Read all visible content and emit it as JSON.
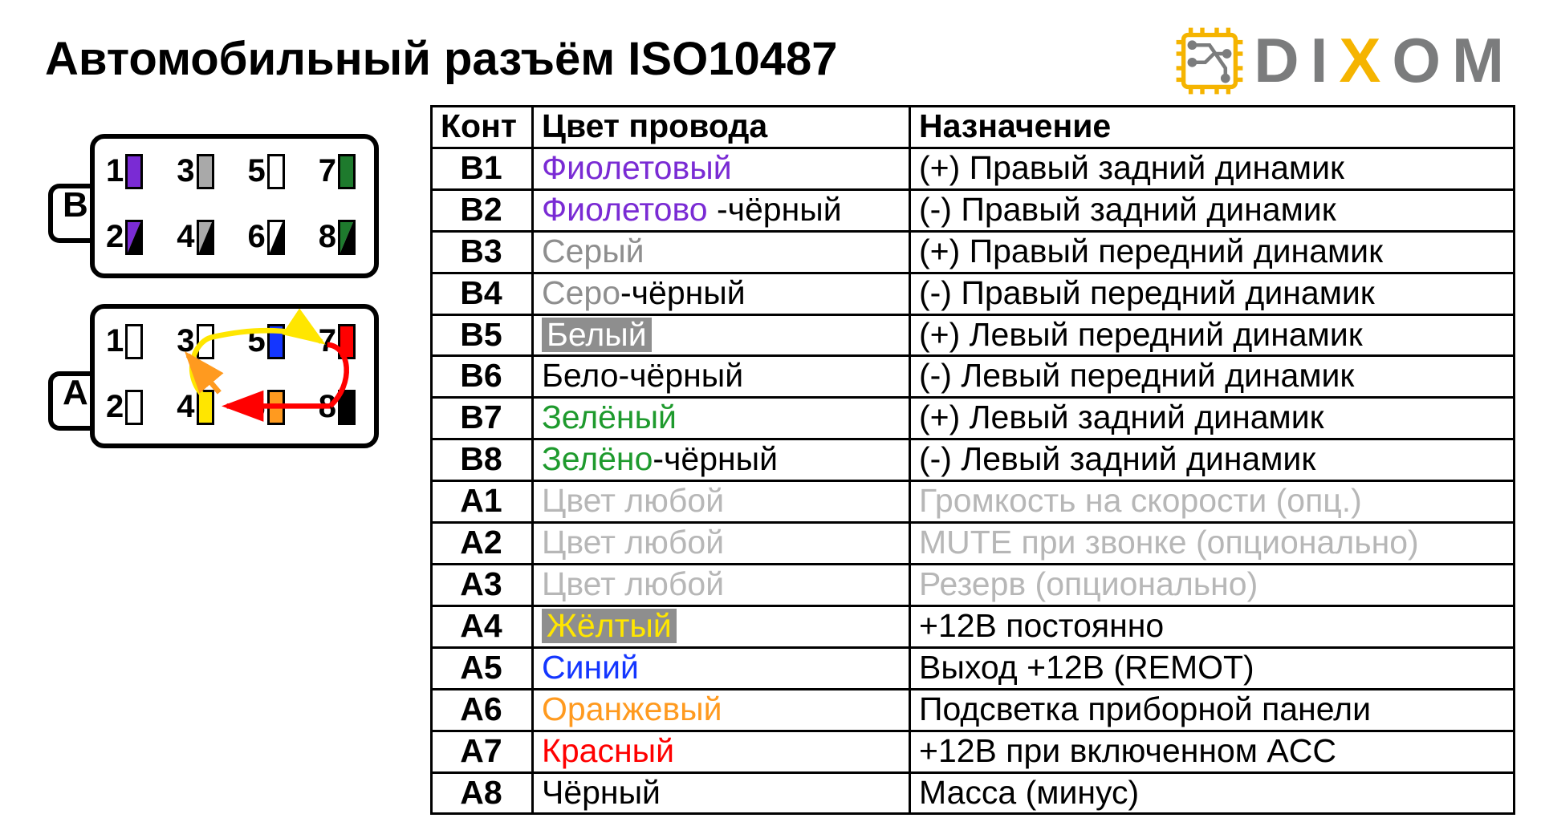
{
  "title": "Автомобильный разъём ISO10487",
  "logo": {
    "d": "D",
    "i": "I",
    "x": "X",
    "o": "O",
    "m": "M"
  },
  "table": {
    "headers": {
      "pin": "Конт",
      "wire": "Цвет провода",
      "func": "Назначение"
    }
  },
  "connector": {
    "labelB": "B",
    "labelA": "A",
    "B": {
      "r1": [
        {
          "n": "1",
          "fill": "#7a2bd4"
        },
        {
          "n": "3",
          "fill": "#a9a9a9"
        },
        {
          "n": "5",
          "fill": "#ffffff"
        },
        {
          "n": "7",
          "fill": "#1e7a2d"
        }
      ],
      "r2": [
        {
          "n": "2",
          "diag": "#7a2bd4"
        },
        {
          "n": "4",
          "diag": "#a9a9a9"
        },
        {
          "n": "6",
          "diag": "#ffffff"
        },
        {
          "n": "8",
          "diag": "#1e7a2d"
        }
      ]
    },
    "A": {
      "r1": [
        {
          "n": "1",
          "fill": "#ffffff"
        },
        {
          "n": "3",
          "fill": "#ffffff"
        },
        {
          "n": "5",
          "fill": "#1436ff"
        },
        {
          "n": "7",
          "fill": "#ff0000"
        }
      ],
      "r2": [
        {
          "n": "2",
          "fill": "#ffffff"
        },
        {
          "n": "4",
          "fill": "#ffe600"
        },
        {
          "n": "6",
          "fill": "#ff9a1f"
        },
        {
          "n": "8",
          "fill": "#000000"
        }
      ]
    }
  },
  "rows": [
    {
      "pin": "B1",
      "wire": [
        {
          "t": "Фиолетовый",
          "c": "#7a2bd4"
        }
      ],
      "func": "(+) Правый задний динамик"
    },
    {
      "pin": "B2",
      "wire": [
        {
          "t": "Фиолетово",
          "c": "#7a2bd4"
        },
        {
          "t": " -чёрный",
          "c": "#000"
        }
      ],
      "func": "(-)  Правый задний динамик"
    },
    {
      "pin": "B3",
      "wire": [
        {
          "t": "Серый",
          "c": "#8e8e8e"
        }
      ],
      "func": "(+) Правый передний динамик"
    },
    {
      "pin": "B4",
      "wire": [
        {
          "t": "Серо",
          "c": "#8e8e8e"
        },
        {
          "t": "-чёрный",
          "c": "#000"
        }
      ],
      "func": "(-)  Правый передний динамик"
    },
    {
      "pin": "B5",
      "wire": [
        {
          "t": "Белый",
          "c": "#ffffff",
          "bg": "#8e8e8e"
        }
      ],
      "func": "(+) Левый передний динамик"
    },
    {
      "pin": "B6",
      "wire": [
        {
          "t": "Бело-чёрный",
          "c": "#000"
        }
      ],
      "func": "(-)  Левый передний динамик"
    },
    {
      "pin": "B7",
      "wire": [
        {
          "t": "Зелёный",
          "c": "#1e9a2d"
        }
      ],
      "func": "(+) Левый задний динамик"
    },
    {
      "pin": "B8",
      "wire": [
        {
          "t": "Зелёно",
          "c": "#1e9a2d"
        },
        {
          "t": "-чёрный",
          "c": "#000"
        }
      ],
      "func": "(-)  Левый задний динамик"
    },
    {
      "pin": "A1",
      "wire": [
        {
          "t": "Цвет любой",
          "c": "#b7b7b7"
        }
      ],
      "func": "Громкость на скорости (опц.)",
      "fc": "#b7b7b7"
    },
    {
      "pin": "A2",
      "wire": [
        {
          "t": "Цвет любой",
          "c": "#b7b7b7"
        }
      ],
      "func": "MUTE при звонке (опционально)",
      "fc": "#b7b7b7"
    },
    {
      "pin": "A3",
      "wire": [
        {
          "t": "Цвет любой",
          "c": "#b7b7b7"
        }
      ],
      "func": "Резерв (опционально)",
      "fc": "#b7b7b7"
    },
    {
      "pin": "A4",
      "wire": [
        {
          "t": "Жёлтый",
          "c": "#ffe600",
          "bg": "#8e8e8e"
        }
      ],
      "func": "+12В постоянно"
    },
    {
      "pin": "A5",
      "wire": [
        {
          "t": "Синий",
          "c": "#1436ff"
        }
      ],
      "func": "Выход +12В (REMOT)"
    },
    {
      "pin": "A6",
      "wire": [
        {
          "t": "Оранжевый",
          "c": "#ff9a1f"
        }
      ],
      "func": "Подсветка приборной панели"
    },
    {
      "pin": "A7",
      "wire": [
        {
          "t": "Красный",
          "c": "#ff0000"
        }
      ],
      "func": "+12В при включенном ACC"
    },
    {
      "pin": "A8",
      "wire": [
        {
          "t": "Чёрный",
          "c": "#000"
        }
      ],
      "func": "Масса (минус)"
    }
  ]
}
